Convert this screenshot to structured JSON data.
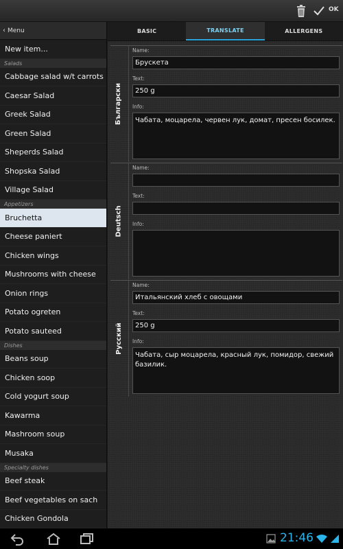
{
  "actionbar": {
    "ok_label": "OK",
    "icons": [
      "trash-icon",
      "check-icon"
    ]
  },
  "sidebar": {
    "header_label": "Menu",
    "new_item": "New item...",
    "sections": [
      {
        "title": "Salads",
        "items": [
          "Cabbage salad w/t carrots",
          "Caesar Salad",
          "Greek Salad",
          "Green Salad",
          "Sheperds Salad",
          "Shopska Salad",
          "Village Salad"
        ]
      },
      {
        "title": "Appetizers",
        "items": [
          "Bruchetta",
          "Cheese paniert",
          "Chicken wings",
          "Mushrooms with cheese",
          "Onion rings",
          "Potato ogreten",
          "Potato sauteed"
        ]
      },
      {
        "title": "Dishes",
        "items": [
          "Beans soup",
          "Chicken soop",
          "Cold yogurt soup",
          "Kawarma",
          "Mashroom soup",
          "Musaka"
        ]
      },
      {
        "title": "Specialty dishes",
        "items": [
          "Beef steak",
          "Beef vegetables on sach",
          "Chicken Gondola"
        ]
      }
    ],
    "selected": "Bruchetta"
  },
  "tabs": [
    {
      "label": "BASIC",
      "active": false
    },
    {
      "label": "TRANSLATE",
      "active": true
    },
    {
      "label": "ALLERGENS",
      "active": false
    }
  ],
  "field_labels": {
    "name": "Name:",
    "text": "Text:",
    "info": "Info:"
  },
  "translations": [
    {
      "language": "Български",
      "name": "Брускета",
      "text": "250 g",
      "info": "Чабата, моцарела, червен лук, домат, пресен босилек."
    },
    {
      "language": "Deutsch",
      "name": "",
      "text": "",
      "info": ""
    },
    {
      "language": "Русский",
      "name": "Итальянский хлеб с овощами",
      "text": "250 g",
      "info": "Чабата, сыр моцарела, красный лук, помидор, свежий базилик."
    }
  ],
  "navbar": {
    "clock": "21:46",
    "accent": "#2ab4ea"
  }
}
